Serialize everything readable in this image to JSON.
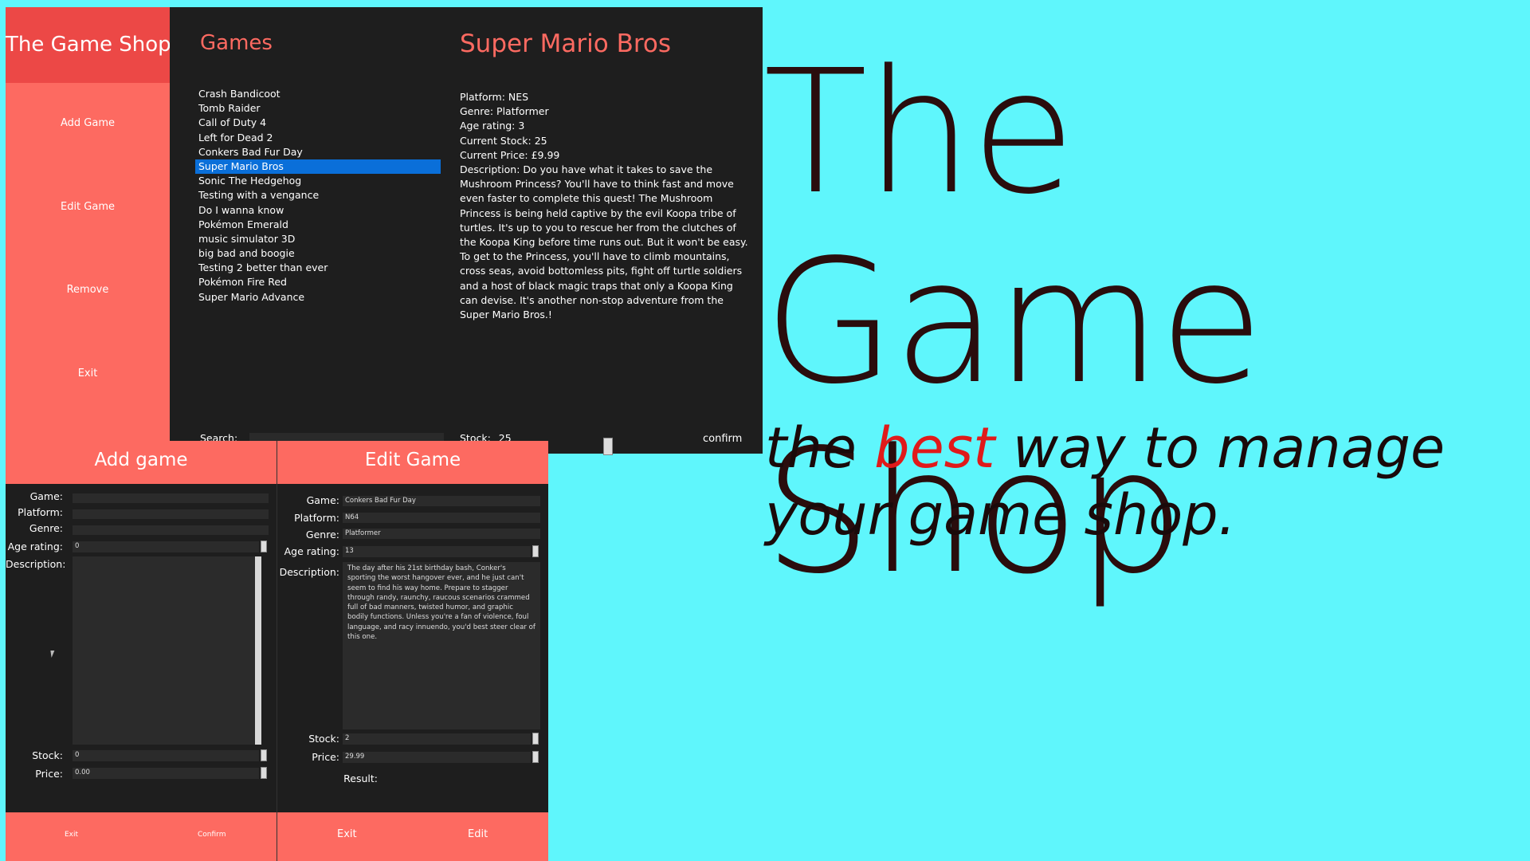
{
  "main": {
    "app_title": "The Game Shop",
    "sidebar": [
      "Add Game",
      "Edit Game",
      "Remove",
      "Exit"
    ],
    "list_heading": "Games",
    "games": [
      "Crash Bandicoot",
      "Tomb Raider",
      "Call of Duty 4",
      "Left for Dead 2",
      "Conkers Bad Fur Day",
      "Super Mario Bros",
      "Sonic The Hedgehog",
      "Testing with a vengance",
      "Do I wanna know",
      "Pokémon Emerald",
      "music simulator 3D",
      "big bad and boogie",
      "Testing 2 better than ever",
      "Pokémon Fire Red",
      "Super Mario Advance"
    ],
    "selected_index": 5,
    "search_label": "Search:",
    "detail": {
      "title": "Super Mario Bros",
      "platform": "Platform: NES",
      "genre": "Genre: Platformer",
      "age": "Age rating: 3",
      "stock": "Current Stock: 25",
      "price": "Current Price: £9.99",
      "description": "Description: Do you have what it takes to save the Mushroom Princess? You'll have to think fast and move even faster to complete this quest! The Mushroom Princess is being held captive by the evil Koopa tribe of turtles. It's up to you to rescue her from the clutches of the Koopa King before time runs out. But it won't be easy. To get to the Princess, you'll have to climb mountains, cross seas, avoid bottomless pits, fight off turtle soldiers and a host of black magic traps that only a Koopa King can devise. It's another non-stop adventure from the Super Mario Bros.!"
    },
    "stock_label": "Stock:",
    "stock_value": "25",
    "confirm": "confirm"
  },
  "add": {
    "title": "Add game",
    "labels": [
      "Game:",
      "Platform:",
      "Genre:",
      "Age rating:",
      "Description:",
      "Stock:",
      "Price:"
    ],
    "age_value": "0",
    "stock_value": "0",
    "price_value": "0.00",
    "exit": "Exit",
    "confirm": "Confirm"
  },
  "edit": {
    "title": "Edit Game",
    "labels": [
      "Game:",
      "Platform:",
      "Genre:",
      "Age rating:",
      "Description:",
      "Stock:",
      "Price:",
      "Result:"
    ],
    "game": "Conkers Bad Fur Day",
    "platform": "N64",
    "genre": "Platformer",
    "age": "13",
    "description": "The day after his 21st birthday bash, Conker's sporting the worst hangover ever, and he just can't seem to find his way home. Prepare to stagger through randy, raunchy, raucous scenarios crammed full of bad manners, twisted humor, and graphic bodily functions. Unless you're a fan of violence, foul language, and racy innuendo, you'd best steer clear of this one.",
    "stock": "2",
    "price": "29.99",
    "exit": "Exit",
    "edit_btn": "Edit"
  },
  "hero": {
    "title": "The Game Shop",
    "tag_pre": "the ",
    "tag_best": "best",
    "tag_post": " way to manage your game shop.",
    "colors": {
      "background": "#5ff6fc",
      "accent": "#fd6a61",
      "best": "#e01a1a"
    }
  }
}
